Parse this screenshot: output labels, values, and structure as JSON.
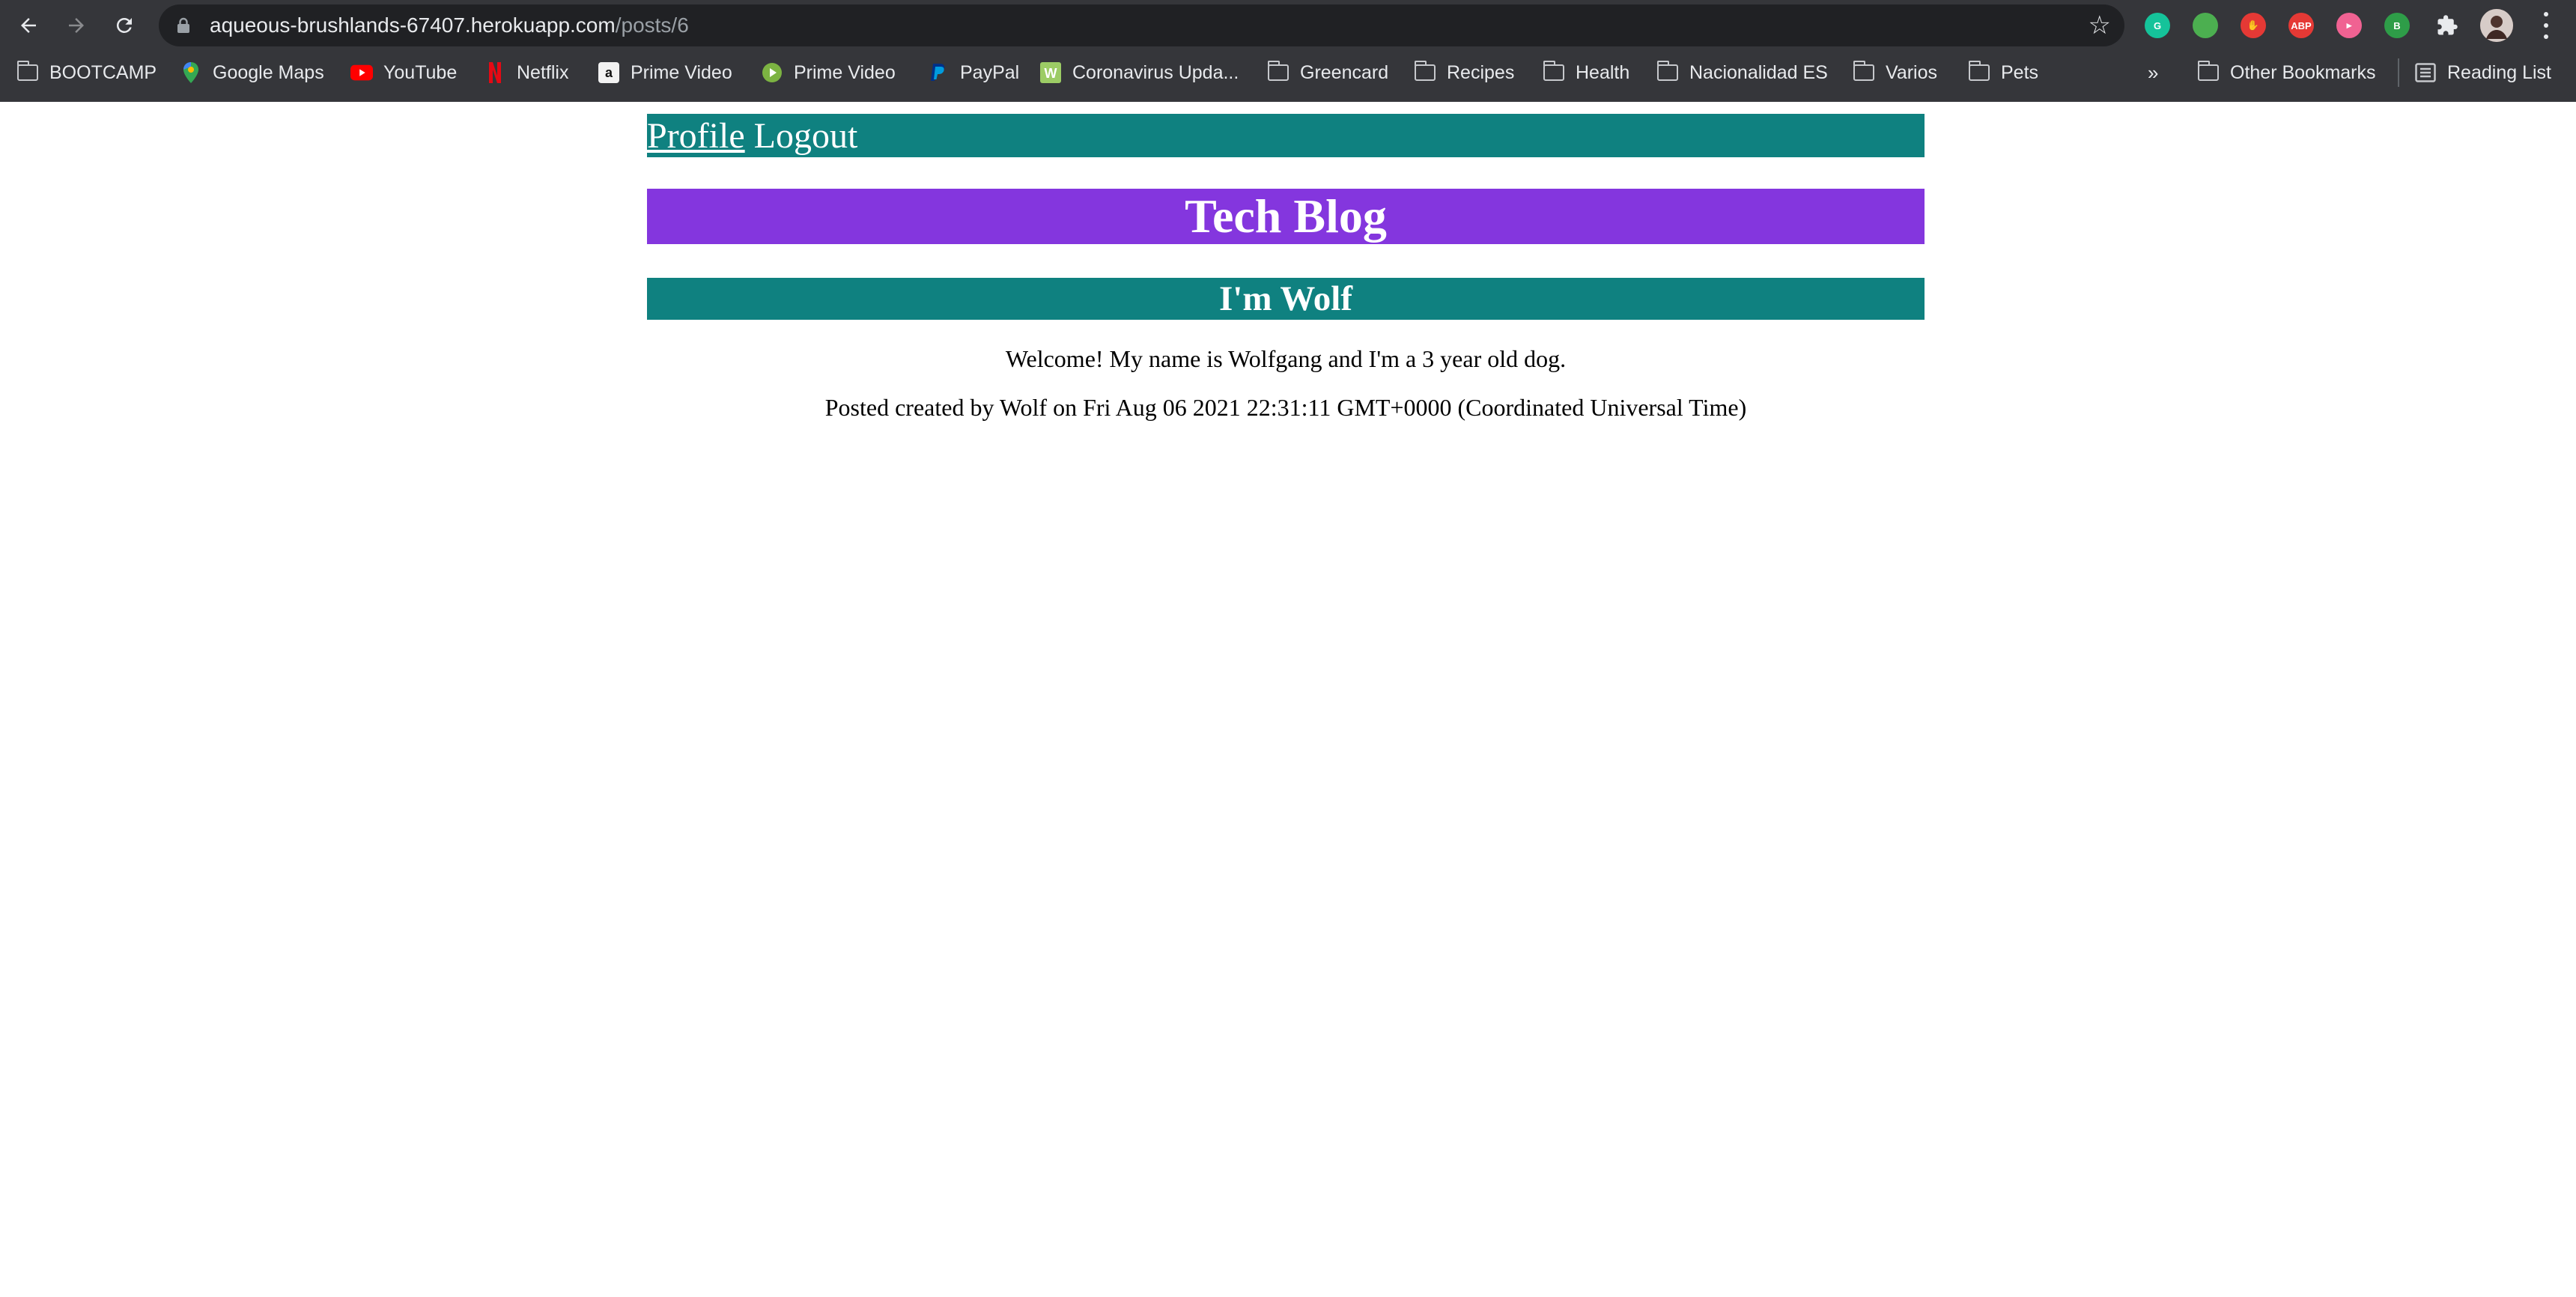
{
  "browser": {
    "url_host": "aqueous-brushlands-67407.herokuapp.com",
    "url_path": "/posts/6",
    "bookmarks": [
      {
        "label": "BOOTCAMP",
        "icon": "folder-icon"
      },
      {
        "label": "Google Maps",
        "icon": "google-maps-icon"
      },
      {
        "label": "YouTube",
        "icon": "youtube-icon"
      },
      {
        "label": "Netflix",
        "icon": "netflix-icon"
      },
      {
        "label": "Prime Video",
        "icon": "amazon-icon"
      },
      {
        "label": "Prime Video",
        "icon": "prime-video-play-icon"
      },
      {
        "label": "PayPal",
        "icon": "paypal-icon"
      },
      {
        "label": "Coronavirus Upda...",
        "icon": "coronavirus-site-icon"
      },
      {
        "label": "Greencard",
        "icon": "folder-icon"
      },
      {
        "label": "Recipes",
        "icon": "folder-icon"
      },
      {
        "label": "Health",
        "icon": "folder-icon"
      },
      {
        "label": "Nacionalidad ES",
        "icon": "folder-icon"
      },
      {
        "label": "Varios",
        "icon": "folder-icon"
      },
      {
        "label": "Pets",
        "icon": "folder-icon"
      }
    ],
    "overflow_label": "»",
    "other_bookmarks": "Other Bookmarks",
    "reading_list": "Reading List",
    "extensions": [
      {
        "name": "grammarly-icon",
        "text": "G",
        "color": "#15c39a"
      },
      {
        "name": "chrome-extension-icon",
        "text": "",
        "color": "#4caf50"
      },
      {
        "name": "stop-hand-icon",
        "text": "✋",
        "color": "#e53935"
      },
      {
        "name": "adblock-plus-icon",
        "text": "ABP",
        "color": "#e53935"
      },
      {
        "name": "video-extension-icon",
        "text": "▸",
        "color": "#f06292"
      },
      {
        "name": "b-extension-icon",
        "text": "B",
        "color": "#2e9d48"
      }
    ]
  },
  "nav": {
    "profile_label": "Profile",
    "logout_label": "Logout"
  },
  "site": {
    "title": "Tech Blog"
  },
  "post": {
    "title": "I'm Wolf",
    "body": "Welcome! My name is Wolfgang and I'm a 3 year old dog.",
    "meta": "Posted created by Wolf on Fri Aug 06 2021 22:31:11 GMT+0000 (Coordinated Universal Time)"
  },
  "colors": {
    "teal": "#0f8180",
    "purple": "#8436de",
    "chrome_bg": "#35363a"
  }
}
